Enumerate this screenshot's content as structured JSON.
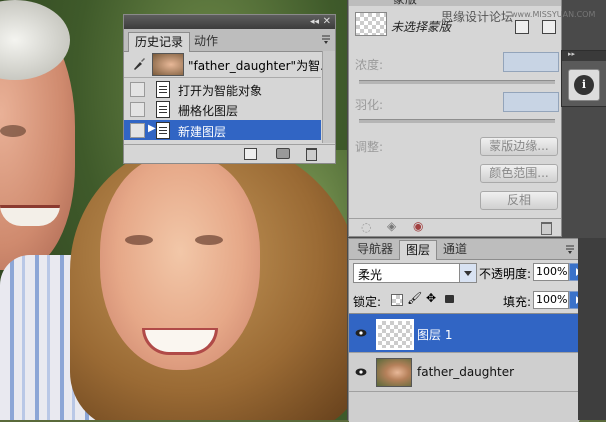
{
  "history": {
    "tabs": [
      {
        "label": "历史记录"
      },
      {
        "label": "动作"
      }
    ],
    "snapshot_label": "\"father_daughter\"为智...",
    "items": [
      {
        "label": "打开为智能对象"
      },
      {
        "label": "栅格化图层"
      },
      {
        "label": "新建图层"
      }
    ]
  },
  "masks": {
    "tab_label": "蒙版",
    "watermark": "思缘设计论坛",
    "watermark_url": "www.MISSYUAN.COM",
    "selection_label": "未选择蒙版",
    "density_label": "浓度:",
    "feather_label": "羽化:",
    "adjust_label": "调整:",
    "buttons": {
      "edge": "蒙版边缘...",
      "color_range": "颜色范围...",
      "invert": "反相"
    }
  },
  "layers": {
    "tabs": [
      {
        "label": "导航器"
      },
      {
        "label": "图层"
      },
      {
        "label": "通道"
      }
    ],
    "blend_mode": "柔光",
    "opacity_label": "不透明度:",
    "opacity_value": "100%",
    "lock_label": "锁定:",
    "fill_label": "填充:",
    "fill_value": "100%",
    "items": [
      {
        "name": "图层 1"
      },
      {
        "name": "father_daughter"
      }
    ]
  },
  "colors": {
    "selection": "#3165c4",
    "panel": "#d6d6d6",
    "panel_dark": "#bdbdbd"
  }
}
